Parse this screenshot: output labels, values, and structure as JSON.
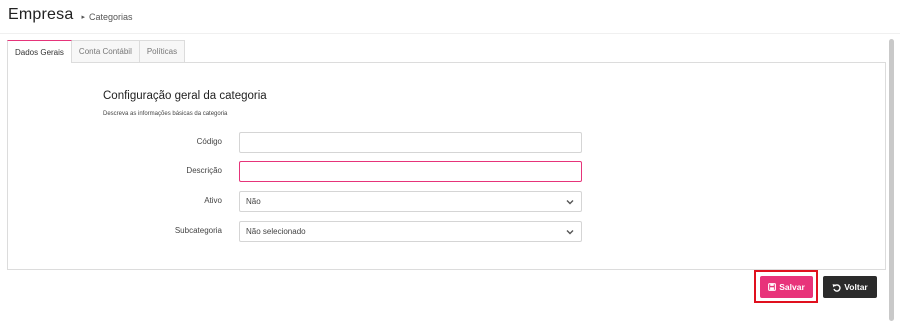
{
  "header": {
    "title": "Empresa",
    "breadcrumb": "Categorias"
  },
  "tabs": [
    {
      "label": "Dados Gerais",
      "active": true
    },
    {
      "label": "Conta Contábil",
      "active": false
    },
    {
      "label": "Políticas",
      "active": false
    }
  ],
  "section": {
    "title": "Configuração geral da categoria",
    "subtitle": "Descreva as informações básicas da categoria"
  },
  "form": {
    "codigo": {
      "label": "Código",
      "value": ""
    },
    "descricao": {
      "label": "Descrição",
      "value": ""
    },
    "ativo": {
      "label": "Ativo",
      "value": "Não"
    },
    "subcategoria": {
      "label": "Subcategoria",
      "value": "Não selecionado"
    }
  },
  "actions": {
    "save_label": "Salvar",
    "back_label": "Voltar"
  },
  "colors": {
    "accent": "#e8337a",
    "dark_button": "#2b2b2b",
    "highlight_outline": "#e0101e"
  },
  "icons": {
    "breadcrumb_separator": "chevron-right-icon",
    "select_arrow": "chevron-down-icon",
    "save": "floppy-disk-icon",
    "back": "undo-arrow-icon"
  }
}
